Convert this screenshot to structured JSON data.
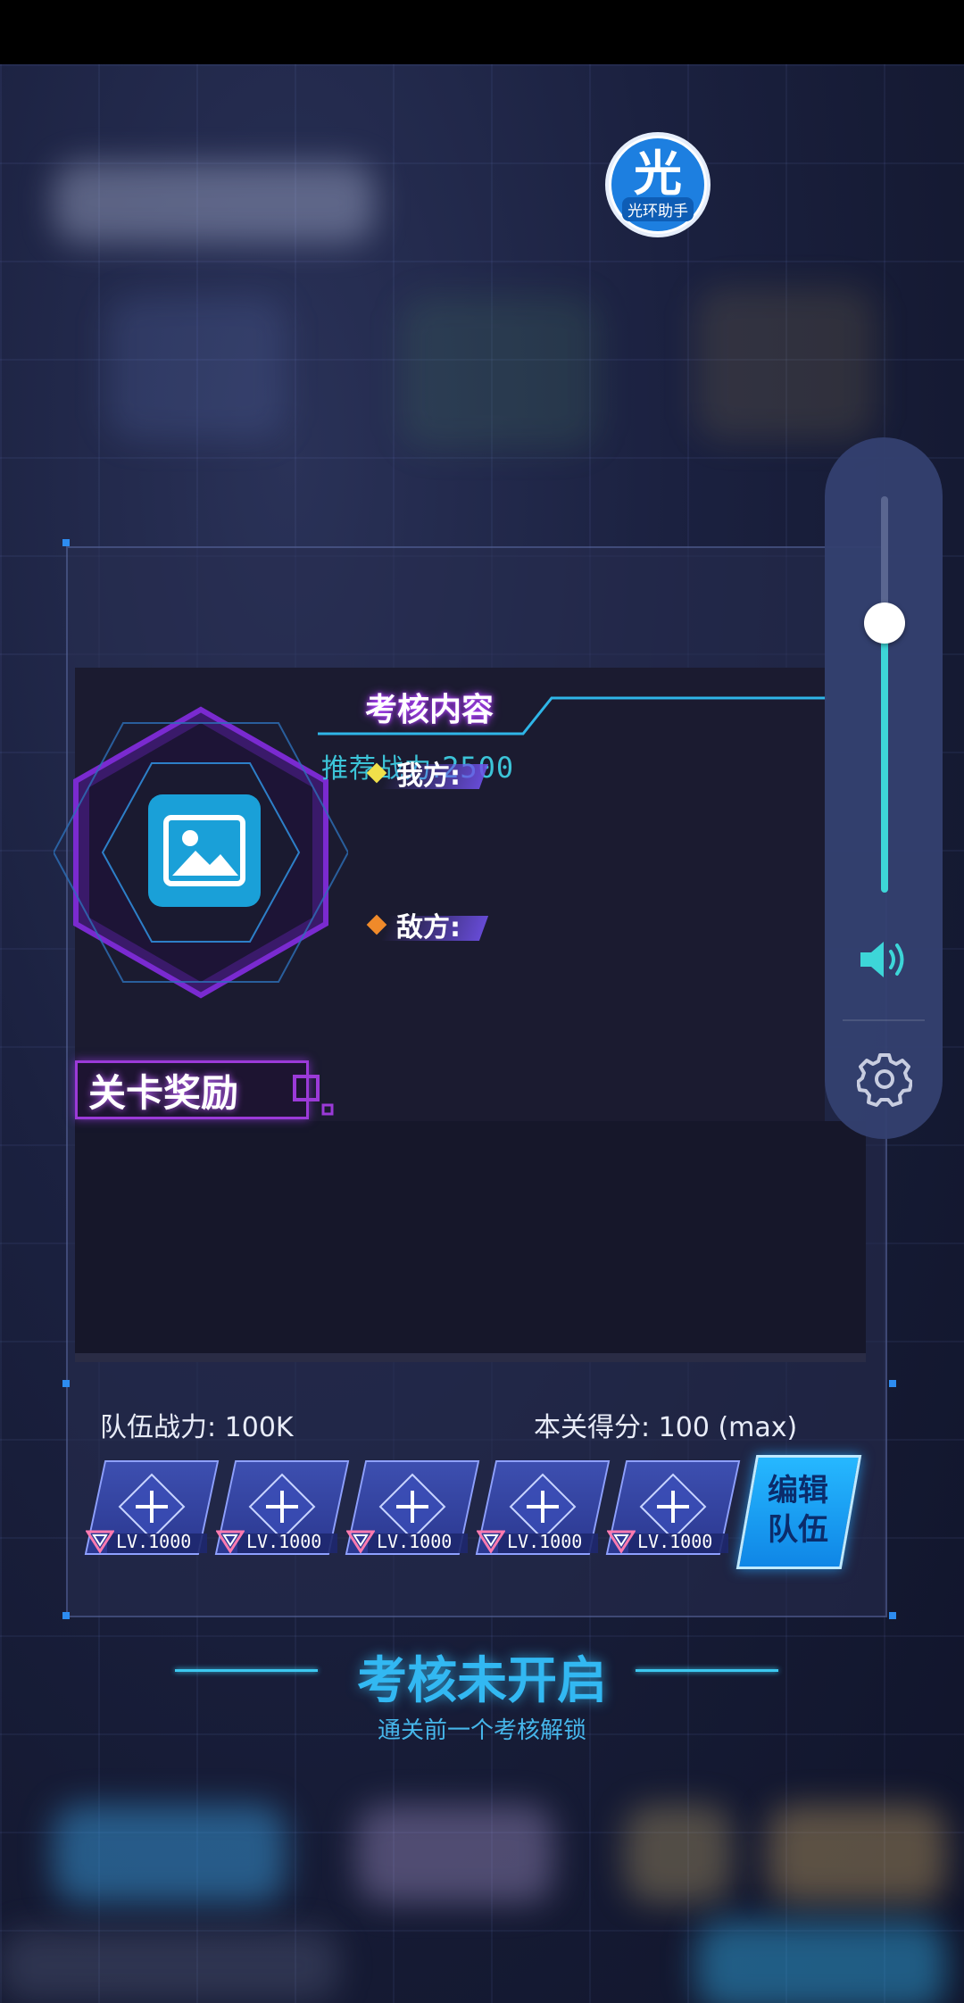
{
  "overlay": {
    "helper_logo_char": "光",
    "helper_logo_label": "光环助手"
  },
  "volume": {
    "level": 0.68,
    "speaker_icon": "speaker-icon",
    "settings_icon": "gear-icon"
  },
  "assessment": {
    "title": "考核内容",
    "recommended_label": "推荐战力:",
    "recommended_value": "2500",
    "ally_label": "我方:",
    "enemy_label": "敌方:",
    "stage_image_icon": "image-icon"
  },
  "rewards": {
    "title": "关卡奖励"
  },
  "team": {
    "power_text": "队伍战力: 100K",
    "score_text": "本关得分: 100 (max)",
    "slots": [
      {
        "level": "LV.1000"
      },
      {
        "level": "LV.1000"
      },
      {
        "level": "LV.1000"
      },
      {
        "level": "LV.1000"
      },
      {
        "level": "LV.1000"
      }
    ],
    "edit_line1": "编辑",
    "edit_line2": "队伍"
  },
  "status": {
    "title": "考核未开启",
    "subtitle": "通关前一个考核解锁"
  },
  "colors": {
    "accent_cyan": "#3cc4d8",
    "accent_purple": "#9b3ad8",
    "edit_button": "#26b8ff",
    "ally_diamond": "#f0e04a",
    "enemy_diamond": "#f08a2a"
  }
}
